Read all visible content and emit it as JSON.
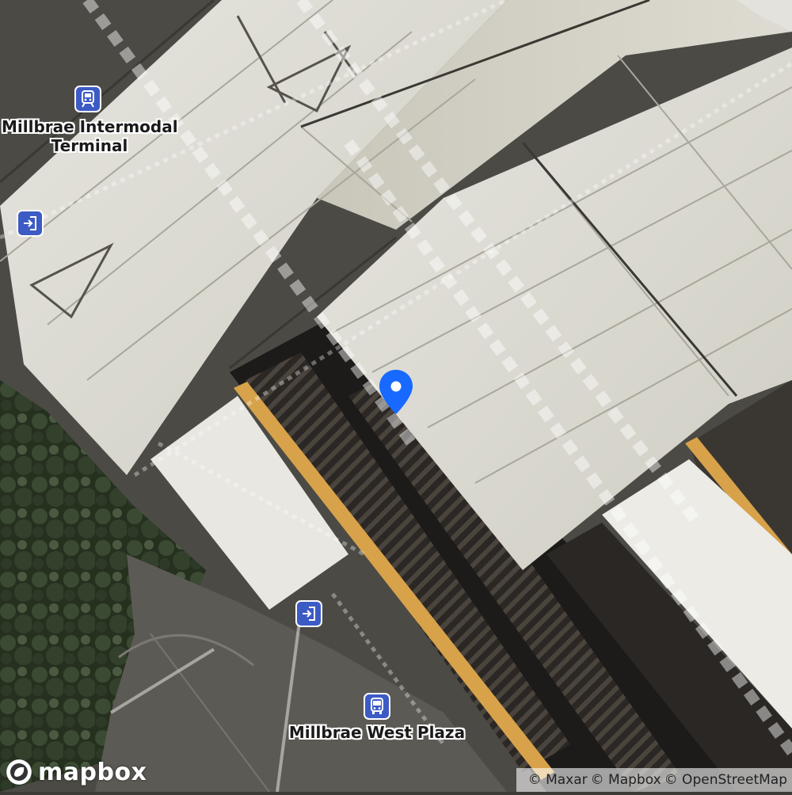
{
  "map": {
    "provider": "mapbox",
    "style": "satellite-streets",
    "marker": {
      "icon": "map-pin-icon",
      "color": "#1769ff"
    },
    "colors": {
      "roof": "#dcdbd3",
      "track": "#2e2a26",
      "platform_edge": "#d7a24a",
      "vegetation": "#2f3a2d",
      "poi_badge": "#3d5bc4"
    }
  },
  "pois": [
    {
      "icon": "rail-station-icon",
      "lines": [
        "Millbrae Intermodal",
        "Terminal"
      ]
    },
    {
      "icon": "entrance-icon",
      "lines": []
    },
    {
      "icon": "entrance-icon",
      "lines": []
    },
    {
      "icon": "bus-stop-icon",
      "lines": [
        "Millbrae West Plaza"
      ]
    }
  ],
  "logo": {
    "text": "mapbox",
    "icon": "mapbox-logo-icon"
  },
  "attribution": [
    "© Maxar",
    "© Mapbox",
    "© OpenStreetMap"
  ]
}
